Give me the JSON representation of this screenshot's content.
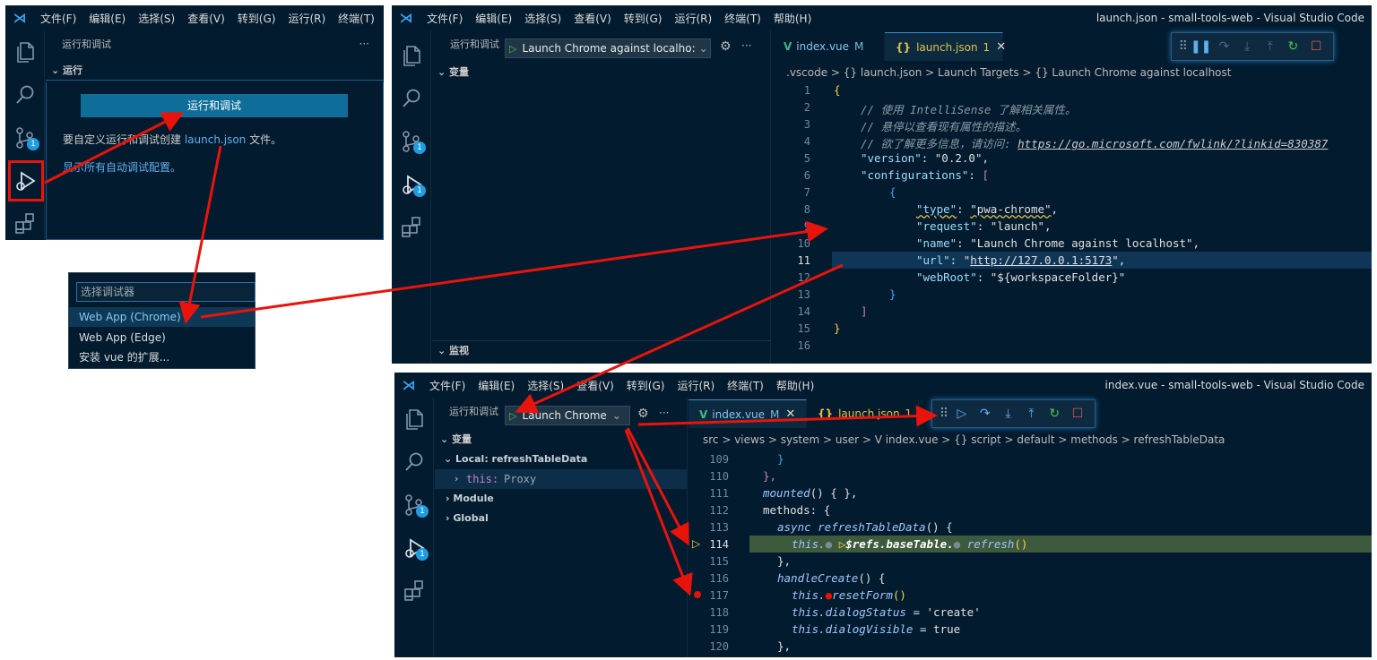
{
  "menu": {
    "items": [
      "文件(F)",
      "编辑(E)",
      "选择(S)",
      "查看(V)",
      "转到(G)",
      "运行(R)",
      "终端(T)",
      "帮助(H)"
    ],
    "panel1_items": [
      "文件(F)",
      "编辑(E)",
      "选择(S)",
      "查看(V)",
      "转到(G)",
      "运行(R)",
      "终端(T)"
    ]
  },
  "panel1": {
    "sidebar_title": "运行和调试",
    "more": "···",
    "section_run": "运行",
    "run_debug_button": "运行和调试",
    "hint_prefix": "要自定义运行和调试创建 ",
    "hint_link": "launch.json",
    "hint_suffix": " 文件。",
    "show_all_configs": "显示所有自动调试配置。",
    "badge_scm": "1"
  },
  "dropdown": {
    "placeholder": "选择调试器",
    "items": [
      "Web App (Chrome)",
      "Web App (Edge)",
      "安装 vue 的扩展..."
    ]
  },
  "panel2": {
    "window_title": "launch.json - small-tools-web - Visual Studio Code",
    "sidebar_title": "运行和调试",
    "launch_config": "Launch Chrome against localho:",
    "section_vars": "变量",
    "section_watch": "监视",
    "badge_scm": "1",
    "badge_debug": "1",
    "tab_vue": "index.vue",
    "tab_vue_mod": "M",
    "tab_json": "launch.json",
    "tab_json_count": "1",
    "breadcrumb": ".vscode  >  {} launch.json  >  Launch Targets  >  {} Launch Chrome against localhost",
    "line_numbers": [
      "1",
      "2",
      "3",
      "4",
      "5",
      "6",
      "7",
      "8",
      "9",
      "10",
      "11",
      "12",
      "13",
      "14",
      "15",
      "16"
    ],
    "code": {
      "l1": "{",
      "l2": "// 使用 IntelliSense 了解相关属性。",
      "l3": "// 悬停以查看现有属性的描述。",
      "l4a": "// 欲了解更多信息，请访问: ",
      "l4b": "https://go.microsoft.com/fwlink/?linkid=830387",
      "l5k": "\"version\"",
      "l5v": ": \"0.2.0\",",
      "l6k": "\"configurations\"",
      "l6v": ": ",
      "l6b": "[",
      "l7": "{",
      "l8k": "\"type\"",
      "l8v": ": ",
      "l8s": "\"pwa-chrome\"",
      "l8e": ",",
      "l9k": "\"request\"",
      "l9v": ": \"launch\",",
      "l10k": "\"name\"",
      "l10v": ": \"Launch Chrome against localhost\",",
      "l11k": "\"url\"",
      "l11a": ": \"",
      "l11u": "http://127.0.0.1:5173",
      "l11b": "\",",
      "l12k": "\"webRoot\"",
      "l12v": ": \"${workspaceFolder}\"",
      "l13": "}",
      "l14": "]",
      "l15": "}"
    }
  },
  "panel3": {
    "window_title": "index.vue - small-tools-web - Visual Studio Code",
    "sidebar_title": "运行和调试",
    "launch_config": "Launch Chrome",
    "section_vars": "变量",
    "local_scope": "Local: refreshTableData",
    "this_label": "this:",
    "this_value": "Proxy",
    "module_scope": "Module",
    "global_scope": "Global",
    "badge_scm": "1",
    "badge_debug": "1",
    "tab_vue": "index.vue",
    "tab_vue_mod": "M",
    "tab_json": "launch.json",
    "tab_json_count": "1",
    "breadcrumb": "src  >  views  >  system  >  user  >  V index.vue  >  {} script  >  default  >  methods  >  refreshTableData",
    "line_numbers": [
      "109",
      "110",
      "111",
      "112",
      "113",
      "114",
      "115",
      "116",
      "117",
      "118",
      "119",
      "120"
    ],
    "code": {
      "l109": "}",
      "l110": "},",
      "l111a": "mounted",
      "l111b": "() { },",
      "l112": "methods: {",
      "l113a": "async ",
      "l113b": "refreshTableData",
      "l113c": "() {",
      "l114a": "this.",
      "l114b": "$refs.baseTable.",
      "l114c": "refresh",
      "l114d": "()",
      "l115": "},",
      "l116a": "handleCreate",
      "l116b": "() {",
      "l117a": "this.",
      "l117b": "resetForm",
      "l117c": "()",
      "l118a": "this.dialogStatus",
      "l118b": " = 'create'",
      "l119a": "this.dialogVisible",
      "l119b": " = true",
      "l120": "},"
    }
  },
  "colors": {
    "background": "#031b2e",
    "arrow": "#e8140c",
    "accent": "#0e6e99",
    "breakpoint": "#e51400",
    "paused_line": "#3e5a3c"
  }
}
